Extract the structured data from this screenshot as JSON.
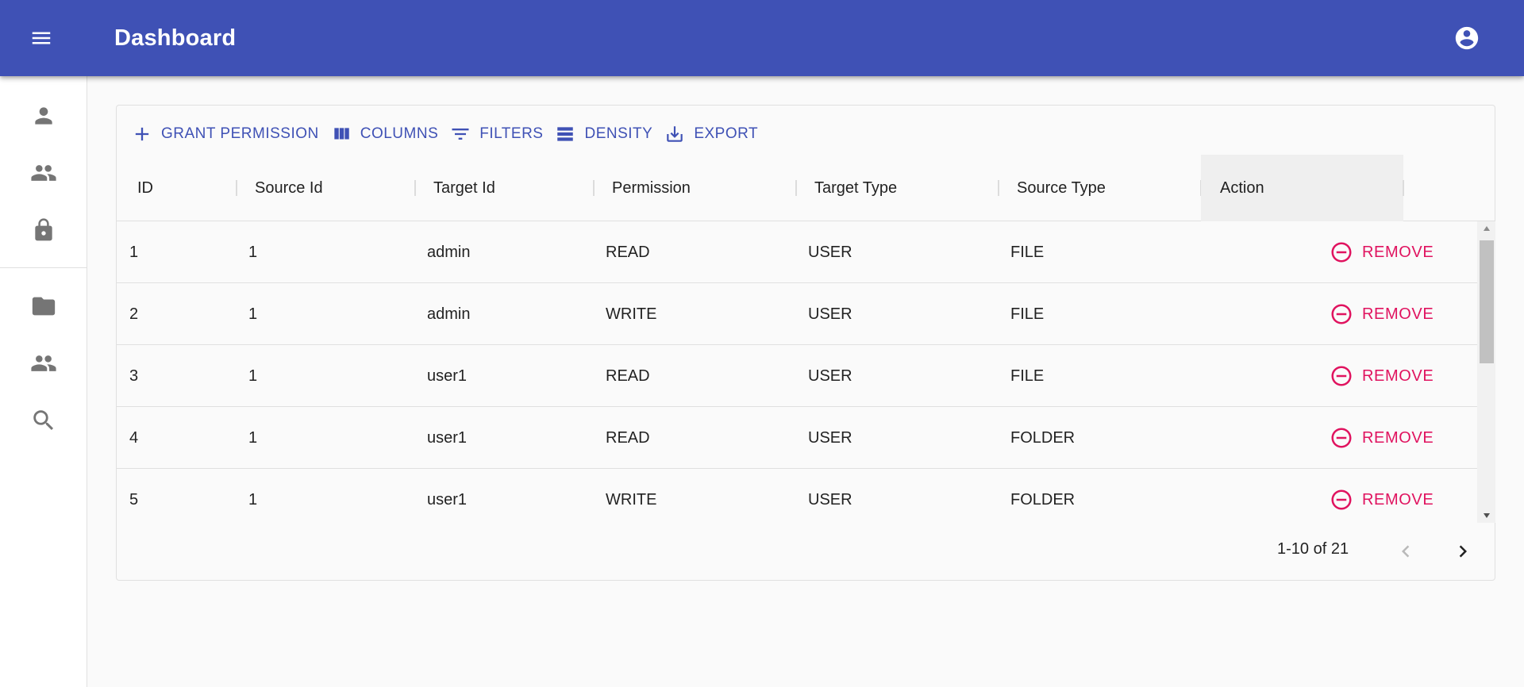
{
  "app": {
    "title": "Dashboard"
  },
  "icons": {
    "menu": "menu-icon",
    "account": "account-circle-icon",
    "add": "add-icon",
    "columns": "view-column-icon",
    "filters": "filter-list-icon",
    "density": "density-icon",
    "export": "export-icon",
    "remove": "remove-circle-outline-icon",
    "prev": "chevron-left-icon",
    "next": "chevron-right-icon"
  },
  "sidebar": {
    "items": [
      {
        "name": "sidebar-item-user",
        "icon": "person-icon"
      },
      {
        "name": "sidebar-item-groups",
        "icon": "people-icon"
      },
      {
        "name": "sidebar-item-permissions",
        "icon": "lock-icon"
      },
      {
        "name": "sidebar-item-folder",
        "icon": "folder-icon"
      },
      {
        "name": "sidebar-item-people",
        "icon": "people-icon"
      },
      {
        "name": "sidebar-item-search",
        "icon": "search-icon"
      }
    ]
  },
  "toolbar": {
    "grant_label": "GRANT PERMISSION",
    "columns_label": "COLUMNS",
    "filters_label": "FILTERS",
    "density_label": "DENSITY",
    "export_label": "EXPORT"
  },
  "table": {
    "columns": [
      "ID",
      "Source Id",
      "Target Id",
      "Permission",
      "Target Type",
      "Source Type",
      "Action"
    ],
    "rows": [
      {
        "id": "1",
        "source_id": "1",
        "target_id": "admin",
        "permission": "READ",
        "target_type": "USER",
        "source_type": "FILE",
        "action": "REMOVE"
      },
      {
        "id": "2",
        "source_id": "1",
        "target_id": "admin",
        "permission": "WRITE",
        "target_type": "USER",
        "source_type": "FILE",
        "action": "REMOVE"
      },
      {
        "id": "3",
        "source_id": "1",
        "target_id": "user1",
        "permission": "READ",
        "target_type": "USER",
        "source_type": "FILE",
        "action": "REMOVE"
      },
      {
        "id": "4",
        "source_id": "1",
        "target_id": "user1",
        "permission": "READ",
        "target_type": "USER",
        "source_type": "FOLDER",
        "action": "REMOVE"
      },
      {
        "id": "5",
        "source_id": "1",
        "target_id": "user1",
        "permission": "WRITE",
        "target_type": "USER",
        "source_type": "FOLDER",
        "action": "REMOVE"
      }
    ]
  },
  "pagination": {
    "info": "1-10 of 21"
  },
  "colors": {
    "primary": "#3f51b5",
    "remove": "#e0135f"
  }
}
